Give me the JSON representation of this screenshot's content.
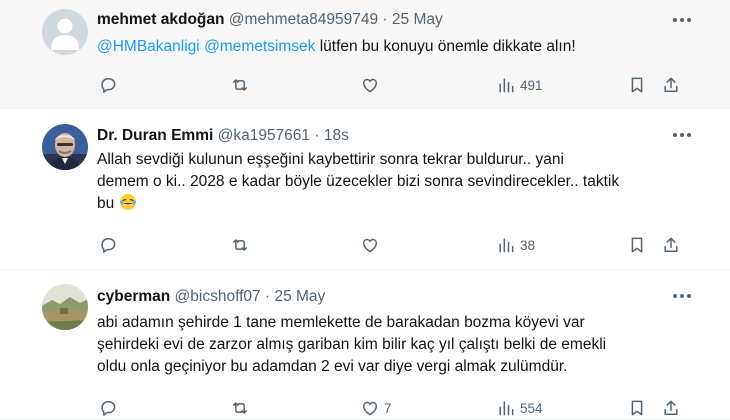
{
  "tweets": [
    {
      "name": "mehmet akdoğan",
      "handle": "@mehmeta84959749",
      "separator": "·",
      "time": "25 May",
      "mentions": [
        "@HMBakanligi",
        "@memetsimsek"
      ],
      "text": " lütfen bu konuyu önemle dikkate alın!",
      "replies": "",
      "retweets": "",
      "likes": "",
      "views": "491",
      "avatar": "default-avatar"
    },
    {
      "name": "Dr. Duran Emmi",
      "handle": "@ka1957661",
      "separator": "·",
      "time": "18s",
      "lines": [
        "Allah sevdiği kulunun eşşeğini kaybettirir sonra tekrar buldurur.. yani",
        "demem o ki.. 2028 e kadar böyle üzecekler bizi sonra sevindirecekler.. taktik",
        "bu"
      ],
      "emoji": "laughing-tears",
      "replies": "",
      "retweets": "",
      "likes": "",
      "views": "38",
      "avatar": "photo-avatar"
    },
    {
      "name": "cyberman",
      "handle": "@bicshoff07",
      "separator": "·",
      "time": "25 May",
      "lines": [
        "abi adamın şehirde 1 tane memlekette de barakadan bozma köyevi var",
        "şehirdeki evi de zarzor almış gariban kim bilir kaç yıl çalıştı belki de emekli",
        "oldu onla geçiniyor bu adamdan 2 evi var diye vergi almak zulümdür."
      ],
      "replies": "",
      "retweets": "",
      "likes": "7",
      "views": "554",
      "avatar": "landscape-avatar"
    }
  ],
  "colors": {
    "mention": "#1d9bf0",
    "secondary": "#536471",
    "text": "#0f1419"
  }
}
